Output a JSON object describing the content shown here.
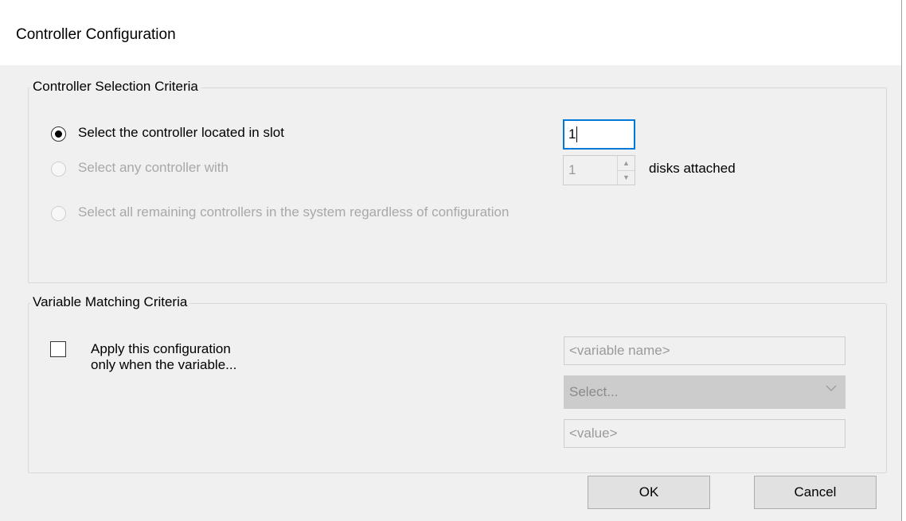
{
  "dialog": {
    "title": "Controller Configuration"
  },
  "selection_group": {
    "legend": "Controller Selection Criteria",
    "options": [
      {
        "label": "Select the controller located in slot",
        "checked": true,
        "enabled": true
      },
      {
        "label": "Select any controller with",
        "checked": false,
        "enabled": false
      },
      {
        "label": "Select all remaining controllers in the system regardless of configuration",
        "checked": false,
        "enabled": false
      }
    ],
    "slot_value": "1",
    "disks_value": "1",
    "disks_suffix": "disks attached"
  },
  "variable_group": {
    "legend": "Variable Matching Criteria",
    "checkbox_label_line1": "Apply this configuration",
    "checkbox_label_line2": "only when the variable...",
    "checked": false,
    "variable_name_placeholder": "<variable name>",
    "operator_selected": "Select...",
    "value_placeholder": "<value>"
  },
  "buttons": {
    "ok": "OK",
    "cancel": "Cancel"
  },
  "colors": {
    "dialog_bg": "#f0f0f0",
    "focus_border": "#0078d7",
    "disabled_text": "#a8a8a8"
  }
}
